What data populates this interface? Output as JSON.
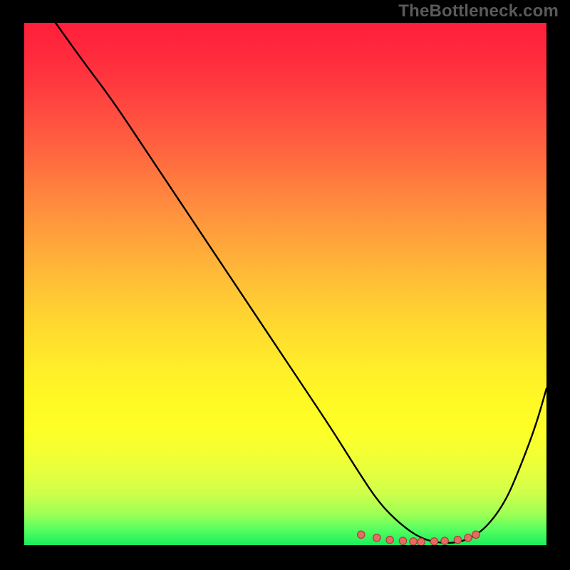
{
  "watermark": "TheBottleneck.com",
  "colors": {
    "frame_bg": "#000000",
    "watermark": "#5a5a5a",
    "curve": "#000000",
    "dot_fill": "#e76a63",
    "dot_stroke": "#a83f3a"
  },
  "chart_data": {
    "type": "line",
    "title": "",
    "xlabel": "",
    "ylabel": "",
    "xlim": [
      0,
      100
    ],
    "ylim": [
      0,
      100
    ],
    "curve": {
      "x": [
        6,
        11,
        17,
        23,
        29,
        35,
        41,
        47,
        53,
        59,
        64,
        68,
        72,
        76,
        80,
        84,
        88,
        92,
        95,
        98,
        100
      ],
      "y": [
        100,
        93,
        85,
        76,
        67,
        58,
        49,
        40,
        31,
        22,
        14,
        8,
        4,
        1.2,
        0.3,
        0.6,
        2.8,
        8,
        15,
        23,
        30
      ]
    },
    "dots": {
      "x": [
        64.5,
        67.5,
        70,
        72.5,
        74.5,
        76,
        78.5,
        80.5,
        83,
        85,
        86.5
      ],
      "y": [
        2.0,
        1.4,
        1.0,
        0.8,
        0.7,
        0.6,
        0.7,
        0.8,
        1.0,
        1.4,
        2.0
      ]
    },
    "gradient_stops": [
      {
        "pos": 0.0,
        "hex": "#ff1f3a"
      },
      {
        "pos": 0.5,
        "hex": "#ffba38"
      },
      {
        "pos": 0.8,
        "hex": "#f4ff32"
      },
      {
        "pos": 1.0,
        "hex": "#1bee5c"
      }
    ]
  }
}
